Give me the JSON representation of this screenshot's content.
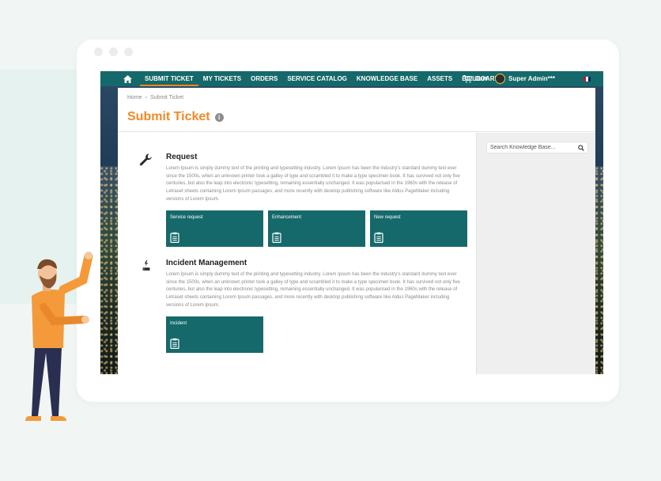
{
  "nav": {
    "items": [
      {
        "label": "SUBMIT TICKET",
        "active": true
      },
      {
        "label": "MY TICKETS"
      },
      {
        "label": "ORDERS"
      },
      {
        "label": "SERVICE CATALOG"
      },
      {
        "label": "KNOWLEDGE BASE"
      },
      {
        "label": "ASSETS"
      },
      {
        "label": "BILLBOARD"
      }
    ],
    "cart_label": "Cart",
    "user_name": "Super Admin***"
  },
  "breadcrumb": {
    "home": "Home",
    "current": "Submit Ticket"
  },
  "page_title": "Submit Ticket",
  "search": {
    "placeholder": "Search Knowledge Base..."
  },
  "sections": [
    {
      "title": "Request",
      "icon": "wrench-icon",
      "description": "Lorem Ipsum is simply dummy text of the printing and typesetting industry. Lorem Ipsum has been the industry's standard dummy text ever since the 1500s, when an unknown printer took a galley of type and scrambled it to make a type specimen book. It has survived not only five centuries, but also the leap into electronic typesetting, remaining essentially unchanged. It was popularised in the 1960s with the release of Letraset sheets containing Lorem Ipsum passages, and more recently with desktop publishing software like Aldus PageMaker including versions of Lorem Ipsum.",
      "tiles": [
        "Service request",
        "Enhancement",
        "New request"
      ]
    },
    {
      "title": "Incident Management",
      "icon": "flash-incident-icon",
      "description": "Lorem Ipsum is simply dummy text of the printing and typesetting industry. Lorem Ipsum has been the industry's standard dummy text ever since the 1500s, when an unknown printer took a galley of type and scrambled it to make a type specimen book. It has survived not only five centuries, but also the leap into electronic typesetting, remaining essentially unchanged. It was popularised in the 1960s with the release of Letraset sheets containing Lorem Ipsum passages, and more recently with desktop publishing software like Aldus PageMaker including versions of Lorem Ipsum.",
      "tiles": [
        "Incident"
      ]
    }
  ],
  "colors": {
    "primary": "#16696a",
    "accent": "#f08a24"
  }
}
